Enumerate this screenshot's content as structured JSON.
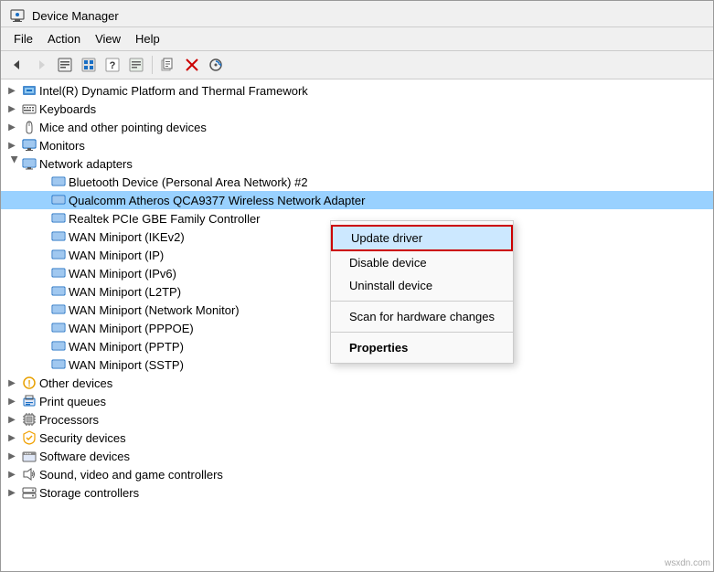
{
  "window": {
    "title": "Device Manager",
    "title_icon": "💻"
  },
  "menu": {
    "items": [
      {
        "label": "File",
        "id": "file"
      },
      {
        "label": "Action",
        "id": "action"
      },
      {
        "label": "View",
        "id": "view"
      },
      {
        "label": "Help",
        "id": "help"
      }
    ]
  },
  "toolbar": {
    "buttons": [
      {
        "id": "back",
        "icon": "◀",
        "disabled": false
      },
      {
        "id": "forward",
        "icon": "▶",
        "disabled": true
      },
      {
        "id": "btn1",
        "icon": "⊞",
        "disabled": false
      },
      {
        "id": "btn2",
        "icon": "▤",
        "disabled": false
      },
      {
        "id": "btn3",
        "icon": "?",
        "disabled": false
      },
      {
        "id": "btn4",
        "icon": "⊡",
        "disabled": false
      },
      {
        "id": "sep1",
        "separator": true
      },
      {
        "id": "btn5",
        "icon": "📄",
        "disabled": false
      },
      {
        "id": "btn6",
        "icon": "✖",
        "disabled": false
      },
      {
        "id": "btn7",
        "icon": "⊕",
        "disabled": false
      }
    ]
  },
  "tree": {
    "items": [
      {
        "id": "intel",
        "level": 0,
        "label": "Intel(R) Dynamic Platform and Thermal Framework",
        "expanded": false,
        "icon": "cpu"
      },
      {
        "id": "keyboards",
        "level": 0,
        "label": "Keyboards",
        "expanded": false,
        "icon": "keyboard"
      },
      {
        "id": "mice",
        "level": 0,
        "label": "Mice and other pointing devices",
        "expanded": false,
        "icon": "mouse"
      },
      {
        "id": "monitors",
        "level": 0,
        "label": "Monitors",
        "expanded": false,
        "icon": "monitor"
      },
      {
        "id": "network",
        "level": 0,
        "label": "Network adapters",
        "expanded": true,
        "icon": "network"
      },
      {
        "id": "bluetooth",
        "level": 1,
        "label": "Bluetooth Device (Personal Area Network) #2",
        "expanded": false,
        "icon": "network"
      },
      {
        "id": "qualcomm",
        "level": 1,
        "label": "Qualcomm Atheros QCA9377 Wireless Network Adapter",
        "expanded": false,
        "icon": "network",
        "selected": true
      },
      {
        "id": "realtek",
        "level": 1,
        "label": "Realtek PCIe GBE Family Controller",
        "expanded": false,
        "icon": "network"
      },
      {
        "id": "wan1",
        "level": 1,
        "label": "WAN Miniport (IKEv2)",
        "expanded": false,
        "icon": "network"
      },
      {
        "id": "wan2",
        "level": 1,
        "label": "WAN Miniport (IP)",
        "expanded": false,
        "icon": "network"
      },
      {
        "id": "wan3",
        "level": 1,
        "label": "WAN Miniport (IPv6)",
        "expanded": false,
        "icon": "network"
      },
      {
        "id": "wan4",
        "level": 1,
        "label": "WAN Miniport (L2TP)",
        "expanded": false,
        "icon": "network"
      },
      {
        "id": "wan5",
        "level": 1,
        "label": "WAN Miniport (Network Monitor)",
        "expanded": false,
        "icon": "network"
      },
      {
        "id": "wan6",
        "level": 1,
        "label": "WAN Miniport (PPPOE)",
        "expanded": false,
        "icon": "network"
      },
      {
        "id": "wan7",
        "level": 1,
        "label": "WAN Miniport (PPTP)",
        "expanded": false,
        "icon": "network"
      },
      {
        "id": "wan8",
        "level": 1,
        "label": "WAN Miniport (SSTP)",
        "expanded": false,
        "icon": "network"
      },
      {
        "id": "other",
        "level": 0,
        "label": "Other devices",
        "expanded": false,
        "icon": "other"
      },
      {
        "id": "print",
        "level": 0,
        "label": "Print queues",
        "expanded": false,
        "icon": "print"
      },
      {
        "id": "processors",
        "level": 0,
        "label": "Processors",
        "expanded": false,
        "icon": "cpu"
      },
      {
        "id": "security",
        "level": 0,
        "label": "Security devices",
        "expanded": false,
        "icon": "security"
      },
      {
        "id": "software",
        "level": 0,
        "label": "Software devices",
        "expanded": false,
        "icon": "software"
      },
      {
        "id": "sound",
        "level": 0,
        "label": "Sound, video and game controllers",
        "expanded": false,
        "icon": "sound"
      },
      {
        "id": "storage",
        "level": 0,
        "label": "Storage controllers",
        "expanded": false,
        "icon": "storage"
      }
    ]
  },
  "context_menu": {
    "items": [
      {
        "id": "update",
        "label": "Update driver",
        "highlighted": true
      },
      {
        "id": "disable",
        "label": "Disable device",
        "highlighted": false
      },
      {
        "id": "uninstall",
        "label": "Uninstall device",
        "highlighted": false
      },
      {
        "id": "sep1",
        "separator": true
      },
      {
        "id": "scan",
        "label": "Scan for hardware changes",
        "highlighted": false
      },
      {
        "id": "sep2",
        "separator": true
      },
      {
        "id": "properties",
        "label": "Properties",
        "bold": true,
        "highlighted": false
      }
    ]
  },
  "watermark": "wsxdn.com"
}
